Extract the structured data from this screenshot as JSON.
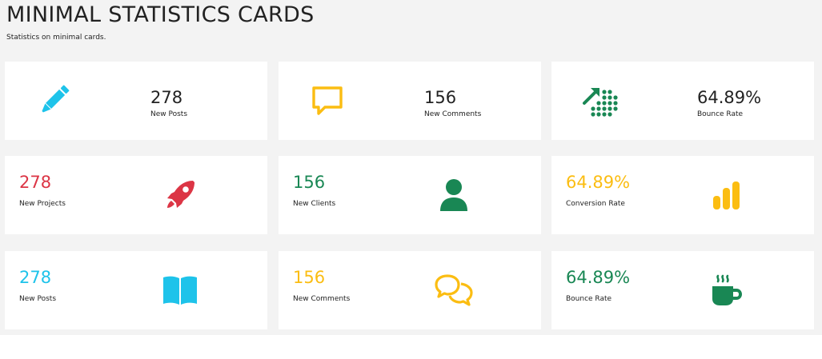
{
  "page": {
    "title": "MINIMAL STATISTICS CARDS",
    "subtitle": "Statistics on minimal cards."
  },
  "colors": {
    "blue": "#1ec3ea",
    "yellow": "#fbbd12",
    "green": "#198754",
    "red": "#dc3545",
    "dark": "#222222"
  },
  "rows": [
    {
      "cards": [
        {
          "value": "278",
          "label": "New Posts",
          "icon": "pencil-icon",
          "color": "#1ec3ea"
        },
        {
          "value": "156",
          "label": "New Comments",
          "icon": "speech-bubble-icon",
          "color": "#fbbd12"
        },
        {
          "value": "64.89%",
          "label": "Bounce Rate",
          "icon": "trend-up-dots-icon",
          "color": "#198754"
        }
      ]
    },
    {
      "cards": [
        {
          "value": "278",
          "label": "New Projects",
          "icon": "rocket-icon",
          "color": "#dc3545"
        },
        {
          "value": "156",
          "label": "New Clients",
          "icon": "user-icon",
          "color": "#198754"
        },
        {
          "value": "64.89%",
          "label": "Conversion Rate",
          "icon": "bar-chart-icon",
          "color": "#fbbd12"
        }
      ]
    },
    {
      "cards": [
        {
          "value": "278",
          "label": "New Posts",
          "icon": "book-icon",
          "color": "#1ec3ea"
        },
        {
          "value": "156",
          "label": "New Comments",
          "icon": "chat-bubbles-icon",
          "color": "#fbbd12"
        },
        {
          "value": "64.89%",
          "label": "Bounce Rate",
          "icon": "coffee-cup-icon",
          "color": "#198754"
        }
      ]
    }
  ]
}
